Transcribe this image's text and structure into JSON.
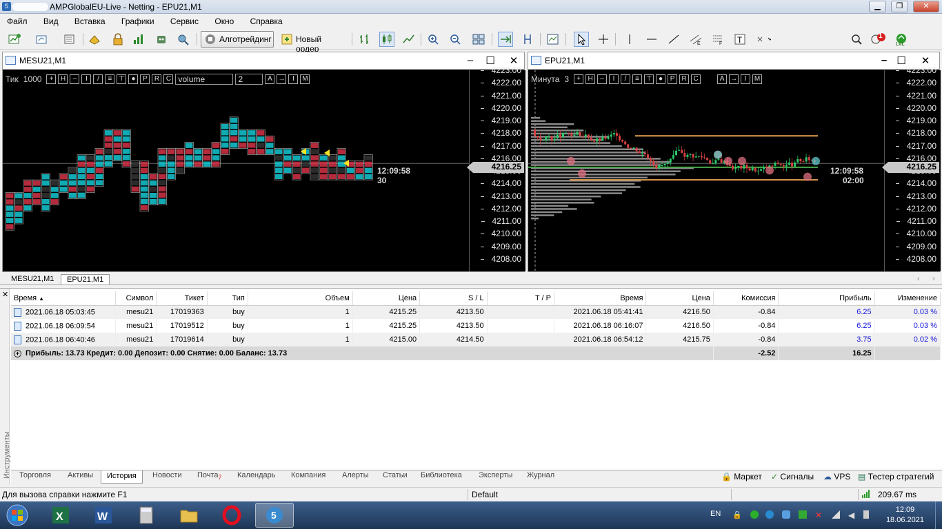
{
  "window": {
    "title": "AMPGlobalEU-Live - Netting - EPU21,M1",
    "min_label": "▁",
    "max_label": "❐",
    "close_label": "✕"
  },
  "menu": [
    "Файл",
    "Вид",
    "Вставка",
    "Графики",
    "Сервис",
    "Окно",
    "Справка"
  ],
  "toolbar": {
    "algo_label": "Алготрейдинг",
    "new_order_label": "Новый ордер",
    "notification_count": "1",
    "lvl_label": "LVL"
  },
  "chart_left": {
    "title": "MESU21,M1",
    "mode_label": "Тик",
    "mode_value": "1000",
    "volume_select": "volume",
    "volume_num": "2",
    "current_price": "4216.25",
    "time_label": "12:09:58",
    "count_label": "30",
    "price_ticks": [
      "4223.00",
      "4222.00",
      "4221.00",
      "4220.00",
      "4219.00",
      "4218.00",
      "4217.00",
      "4216.00",
      "4215.00",
      "4214.00",
      "4213.00",
      "4212.00",
      "4211.00",
      "4210.00",
      "4209.00",
      "4208.00"
    ]
  },
  "chart_right": {
    "title": "EPU21,M1",
    "mode_label": "Минута",
    "mode_value": "3",
    "current_price": "4216.25",
    "time_label": "12:09:58",
    "timer_label": "02:00",
    "price_ticks": [
      "4223.00",
      "4222.00",
      "4221.00",
      "4220.00",
      "4219.00",
      "4218.00",
      "4217.00",
      "4216.00",
      "4215.00",
      "4214.00",
      "4213.00",
      "4212.00",
      "4211.00",
      "4210.00",
      "4209.00",
      "4208.00"
    ]
  },
  "chart_tabs": [
    "MESU21,M1",
    "EPU21,M1"
  ],
  "table": {
    "headers": [
      "Время",
      "Символ",
      "Тикет",
      "Тип",
      "Объем",
      "Цена",
      "S / L",
      "T / P",
      "Время",
      "Цена",
      "Комиссия",
      "Прибыль",
      "Изменение"
    ],
    "rows": [
      [
        "2021.06.18 05:03:45",
        "mesu21",
        "17019363",
        "buy",
        "1",
        "4215.25",
        "4213.50",
        "",
        "2021.06.18 05:41:41",
        "4216.50",
        "-0.84",
        "6.25",
        "0.03 %"
      ],
      [
        "2021.06.18 06:09:54",
        "mesu21",
        "17019512",
        "buy",
        "1",
        "4215.25",
        "4213.50",
        "",
        "2021.06.18 06:16:07",
        "4216.50",
        "-0.84",
        "6.25",
        "0.03 %"
      ],
      [
        "2021.06.18 06:40:46",
        "mesu21",
        "17019614",
        "buy",
        "1",
        "4215.00",
        "4214.50",
        "",
        "2021.06.18 06:54:12",
        "4215.75",
        "-0.84",
        "3.75",
        "0.02 %"
      ]
    ],
    "summary": "Прибыль: 13.73  Кредит: 0.00  Депозит: 0.00  Снятие: 0.00  Баланс: 13.73",
    "total_commission": "-2.52",
    "total_profit": "16.25"
  },
  "side_label": "Инструменты",
  "term_tabs": [
    "Торговля",
    "Активы",
    "История",
    "Новости",
    "Почта",
    "Календарь",
    "Компания",
    "Алерты",
    "Статьи",
    "Библиотека",
    "Эксперты",
    "Журнал"
  ],
  "mail_badge": "7",
  "right_tabs": [
    "Маркет",
    "Сигналы",
    "VPS",
    "Тестер стратегий"
  ],
  "status": {
    "help": "Для вызова справки нажмите F1",
    "profile": "Default",
    "ping": "209.67 ms"
  },
  "taskbar": {
    "lang": "EN",
    "time": "12:09",
    "date": "18.06.2021"
  },
  "colors": {
    "bull_cell": "#14c8d2",
    "bear_cell": "#d23246",
    "profile_bar": "#8a8a8a",
    "level_orange": "#e6a050",
    "level_green": "#4aa84a"
  }
}
